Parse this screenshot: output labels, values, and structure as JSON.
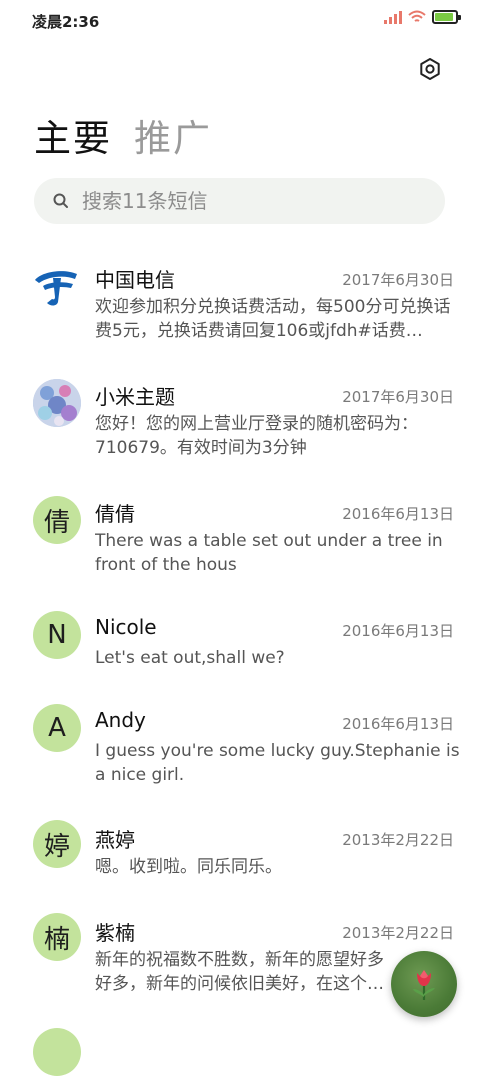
{
  "status_bar": {
    "time": "凌晨2:36"
  },
  "tabs": [
    {
      "label": "主要"
    },
    {
      "label": "推广"
    }
  ],
  "search": {
    "placeholder": "搜索11条短信"
  },
  "conversations": [
    {
      "name": "中国电信",
      "date": "2017年6月30日",
      "preview": "欢迎参加积分兑换话费活动，每500分可兑换话费5元，兑换话费请回复106或jfdh#话费…",
      "avatar": "telecom-logo"
    },
    {
      "name": "小米主题",
      "date": "2017年6月30日",
      "preview": "您好！您的网上营业厅登录的随机密码为：710679。有效时间为3分钟",
      "avatar": "theme-image"
    },
    {
      "name": "倩倩",
      "date": "2016年6月13日",
      "preview": "There was a table set out under a tree in front of the hous",
      "avatar_text": "倩"
    },
    {
      "name": "Nicole",
      "date": "2016年6月13日",
      "preview": "Let's eat out,shall we?",
      "avatar_text": "N"
    },
    {
      "name": "Andy",
      "date": "2016年6月13日",
      "preview": "I guess you're some lucky guy.Stephanie is a nice girl.",
      "avatar_text": "A"
    },
    {
      "name": "燕婷",
      "date": "2013年2月22日",
      "preview": "嗯。收到啦。同乐同乐。",
      "avatar_text": "婷"
    },
    {
      "name": "紫楠",
      "date": "2013年2月22日",
      "preview": "新年的祝福数不胜数，新年的愿望好多好多，新年的问候依旧美好，在这个温馨的时刻",
      "avatar_text": "楠"
    }
  ],
  "colors": {
    "avatar_bg": "#c3e39c",
    "accent_green": "#4b7b37",
    "telecom_blue": "#1663b5"
  },
  "icons": {
    "settings": "settings-hexagon-icon",
    "search": "search-icon",
    "compose": "tulip-icon"
  }
}
